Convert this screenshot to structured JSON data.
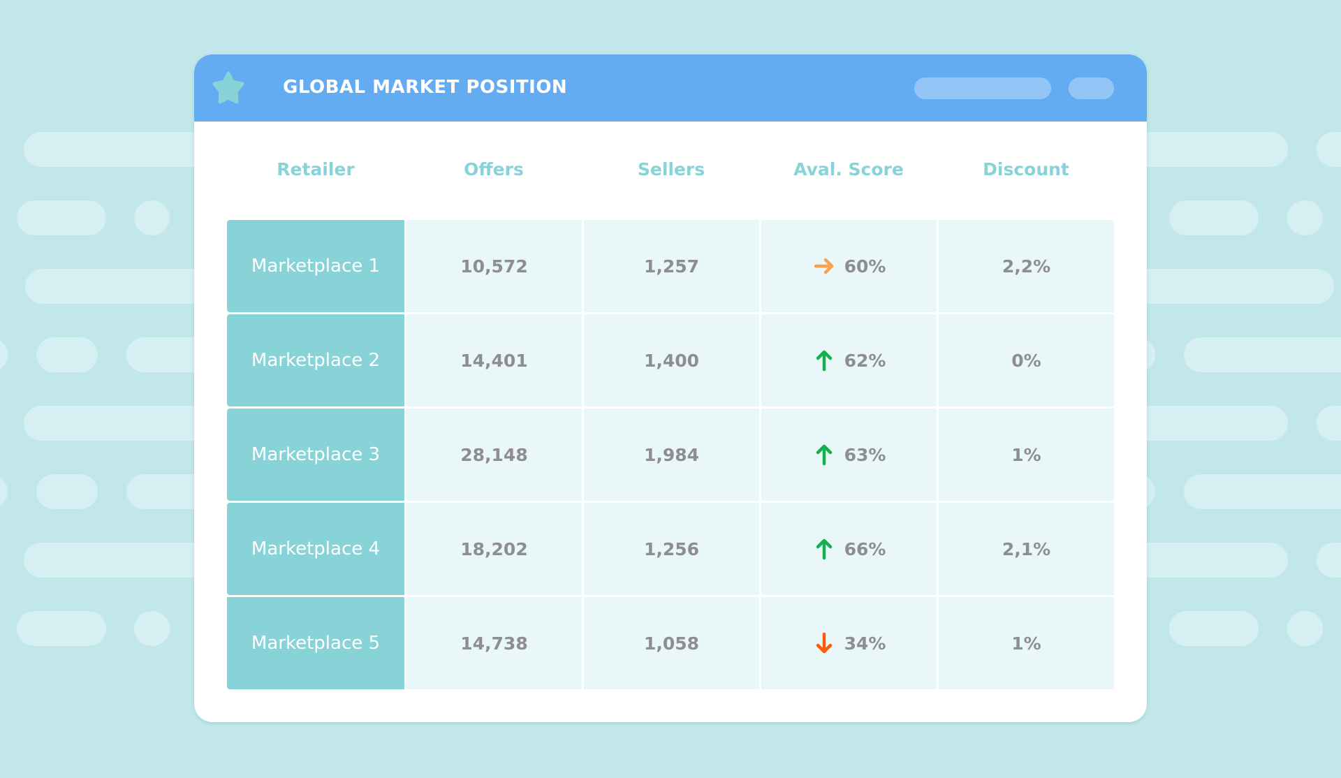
{
  "header": {
    "title": "GLOBAL MARKET POSITION",
    "icon": "star-icon"
  },
  "columns": [
    "Retailer",
    "Offers",
    "Sellers",
    "Aval. Score",
    "Discount"
  ],
  "rows": [
    {
      "retailer": "Marketplace 1",
      "offers": "10,572",
      "sellers": "1,257",
      "trend": "flat",
      "score": "60%",
      "discount": "2,2%"
    },
    {
      "retailer": "Marketplace 2",
      "offers": "14,401",
      "sellers": "1,400",
      "trend": "up",
      "score": "62%",
      "discount": "0%"
    },
    {
      "retailer": "Marketplace 3",
      "offers": "28,148",
      "sellers": "1,984",
      "trend": "up",
      "score": "63%",
      "discount": "1%"
    },
    {
      "retailer": "Marketplace 4",
      "offers": "18,202",
      "sellers": "1,256",
      "trend": "up",
      "score": "66%",
      "discount": "2,1%"
    },
    {
      "retailer": "Marketplace 5",
      "offers": "14,738",
      "sellers": "1,058",
      "trend": "down",
      "score": "34%",
      "discount": "1%"
    }
  ],
  "colors": {
    "background": "#c2e7ea",
    "header": "#63acf2",
    "accent": "#88d3d8",
    "trend_flat": "#fba04c",
    "trend_up": "#12b04f",
    "trend_down": "#ff5a0a",
    "value_text": "#8e8e8e"
  }
}
